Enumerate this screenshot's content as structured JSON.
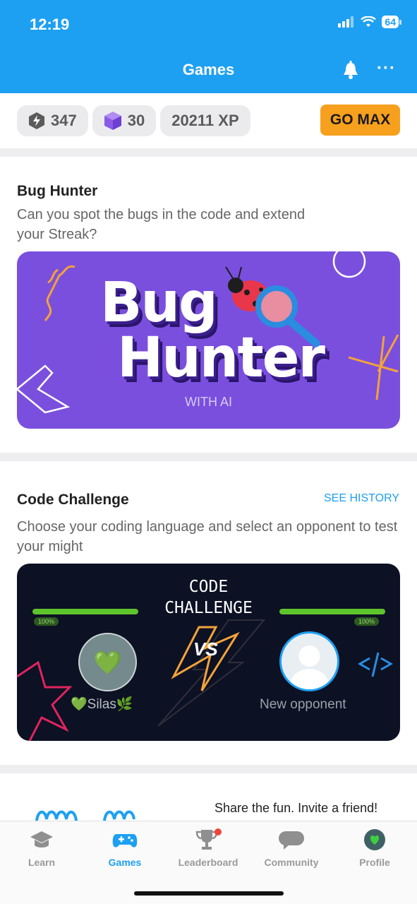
{
  "status_bar": {
    "time": "12:19",
    "battery": "64"
  },
  "header": {
    "title": "Games"
  },
  "stats": {
    "gems": "347",
    "cubes": "30",
    "xp": "20211 XP",
    "upgrade_label": "GO MAX"
  },
  "bug_hunter": {
    "title": "Bug Hunter",
    "description": "Can you spot the bugs in the code and extend your Streak?",
    "banner_line1": "Bug",
    "banner_line2": "Hunter",
    "banner_subtitle": "WITH AI"
  },
  "code_challenge": {
    "title": "Code Challenge",
    "history_link": "SEE HISTORY",
    "description": "Choose your coding language and select an opponent to test your might",
    "banner_line1": "CODE",
    "banner_line2": "CHALLENGE",
    "vs_label": "VS",
    "player_name": "💚Silas🌿",
    "opponent_name": "New opponent",
    "player_health": "100%",
    "opponent_health": "100%",
    "player_avatar": "💚"
  },
  "invite": {
    "text": "Share the fun. Invite a friend!"
  },
  "tabs": [
    {
      "label": "Learn",
      "icon": "graduation-cap-icon"
    },
    {
      "label": "Games",
      "icon": "gamepad-icon"
    },
    {
      "label": "Leaderboard",
      "icon": "trophy-icon"
    },
    {
      "label": "Community",
      "icon": "chat-bubble-icon"
    },
    {
      "label": "Profile",
      "icon": "profile-avatar-icon"
    }
  ],
  "colors": {
    "brand_blue": "#1ea0f2",
    "go_max_orange": "#f7a01e",
    "bug_card_purple": "#7a4fde",
    "code_card_navy": "#0c1124",
    "health_green": "#5ec42b"
  }
}
